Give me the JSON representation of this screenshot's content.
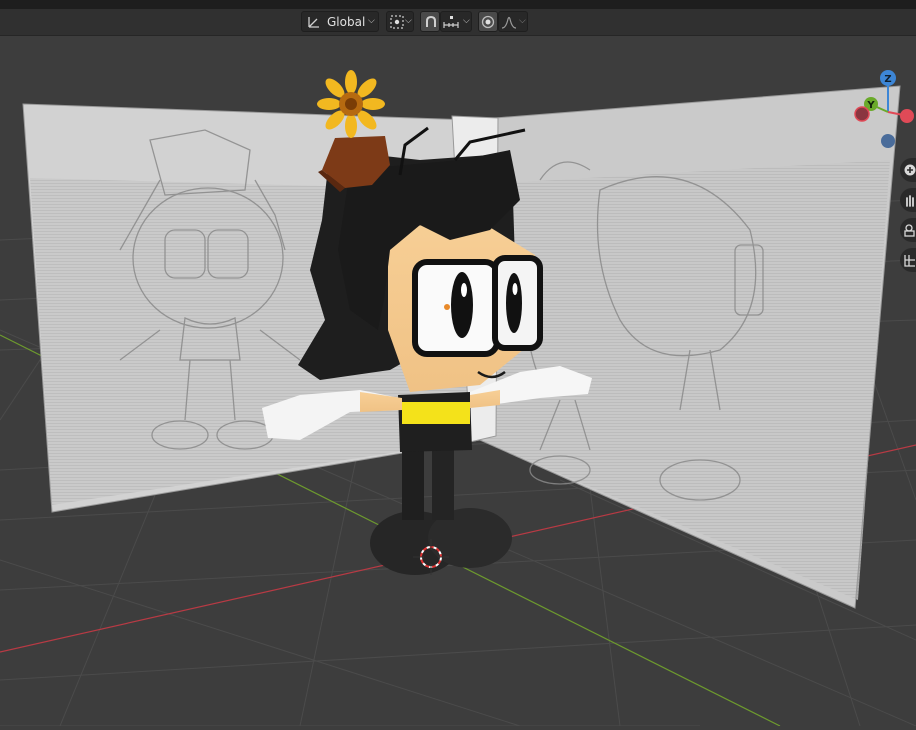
{
  "toolbar": {
    "orientation_label": "Global",
    "icons": [
      "transform-orientation-icon",
      "pivot-point-icon",
      "snap-icon",
      "snap-increment-icon",
      "proportional-editing-icon",
      "falloff-curve-icon"
    ]
  },
  "gizmo": {
    "z_label": "Z",
    "y_label": "Y",
    "x_color": "#e04a57",
    "y_color": "#6aaa2a",
    "z_color": "#3d86d6"
  },
  "viewport_tools": [
    "zoom-icon",
    "pan-hand-icon",
    "camera-view-icon",
    "grid-ortho-icon"
  ],
  "colors": {
    "background": "#3d3d3d",
    "grid": "#4a4a4a",
    "x_axis": "#b83a44",
    "y_axis": "#6d9a2e",
    "header": "#303030"
  }
}
